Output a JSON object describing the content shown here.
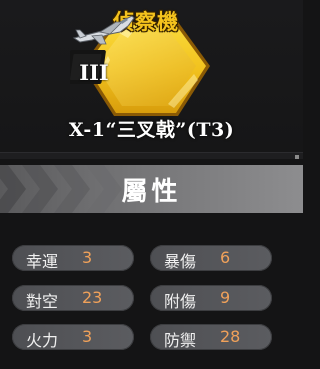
{
  "equipment": {
    "type_label": "偵察機",
    "tier": "III",
    "name": "X-1“三叉戟”(T3)",
    "icon": "aircraft-icon",
    "badge_color": "#f2c21e"
  },
  "attributes": {
    "title": "屬性",
    "stats": [
      {
        "label": "幸運",
        "value": "3"
      },
      {
        "label": "暴傷",
        "value": "6"
      },
      {
        "label": "對空",
        "value": "23"
      },
      {
        "label": "附傷",
        "value": "9"
      },
      {
        "label": "火力",
        "value": "3"
      },
      {
        "label": "防禦",
        "value": "28"
      }
    ],
    "value_color": "#f0a15a"
  }
}
